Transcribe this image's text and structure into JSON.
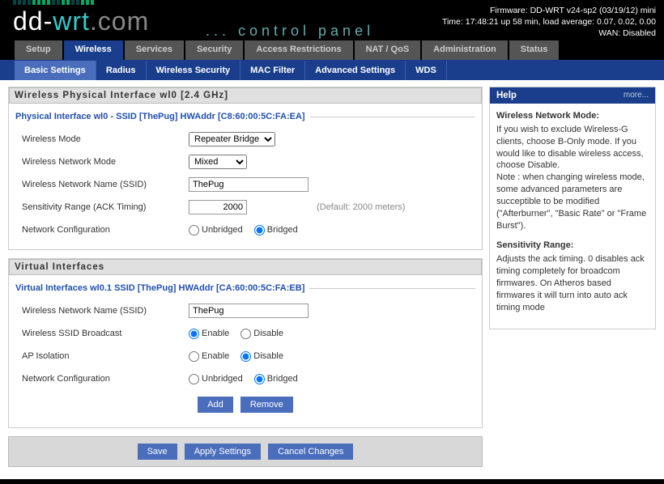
{
  "status": {
    "firmware": "Firmware: DD-WRT v24-sp2 (03/19/12) mini",
    "time": "Time: 17:48:21 up 58 min, load average: 0.07, 0.02, 0.00",
    "wan": "WAN: Disabled"
  },
  "logo": {
    "prefix": "dd-",
    "mid": "wrt",
    "suffix": ".com",
    "subtitle": "... control panel"
  },
  "tabs": {
    "main": [
      "Setup",
      "Wireless",
      "Services",
      "Security",
      "Access Restrictions",
      "NAT / QoS",
      "Administration",
      "Status"
    ],
    "sub": [
      "Basic Settings",
      "Radius",
      "Wireless Security",
      "MAC Filter",
      "Advanced Settings",
      "WDS"
    ]
  },
  "physical": {
    "box_title": "Wireless Physical Interface wl0 [2.4 GHz]",
    "section": "Physical Interface wl0 - SSID [ThePug] HWAddr [C8:60:00:5C:FA:EA]",
    "labels": {
      "mode": "Wireless Mode",
      "net_mode": "Wireless Network Mode",
      "ssid": "Wireless Network Name (SSID)",
      "sens": "Sensitivity Range (ACK Timing)",
      "netconf": "Network Configuration"
    },
    "mode": "Repeater Bridge",
    "net_mode": "Mixed",
    "ssid": "ThePug",
    "sens": "2000",
    "sens_hint": "(Default: 2000 meters)",
    "unbridged": "Unbridged",
    "bridged": "Bridged"
  },
  "virtual": {
    "box_title": "Virtual Interfaces",
    "section": "Virtual Interfaces wl0.1 SSID [ThePug] HWAddr [CA:60:00:5C:FA:EB]",
    "labels": {
      "ssid": "Wireless Network Name (SSID)",
      "broadcast": "Wireless SSID Broadcast",
      "ap_iso": "AP Isolation",
      "netconf": "Network Configuration"
    },
    "ssid": "ThePug",
    "enable": "Enable",
    "disable": "Disable",
    "unbridged": "Unbridged",
    "bridged": "Bridged"
  },
  "buttons": {
    "add": "Add",
    "remove": "Remove",
    "save": "Save",
    "apply": "Apply Settings",
    "cancel": "Cancel Changes"
  },
  "help": {
    "title": "Help",
    "more": "more...",
    "h1": "Wireless Network Mode:",
    "p1": "If you wish to exclude Wireless-G clients, choose B-Only mode. If you would like to disable wireless access, choose Disable.",
    "note": "Note : when changing wireless mode, some advanced parameters are succeptible to be modified (\"Afterburner\", \"Basic Rate\" or \"Frame Burst\").",
    "h2": "Sensitivity Range:",
    "p2": "Adjusts the ack timing. 0 disables ack timing completely for broadcom firmwares. On Atheros based firmwares it will turn into auto ack timing mode"
  }
}
